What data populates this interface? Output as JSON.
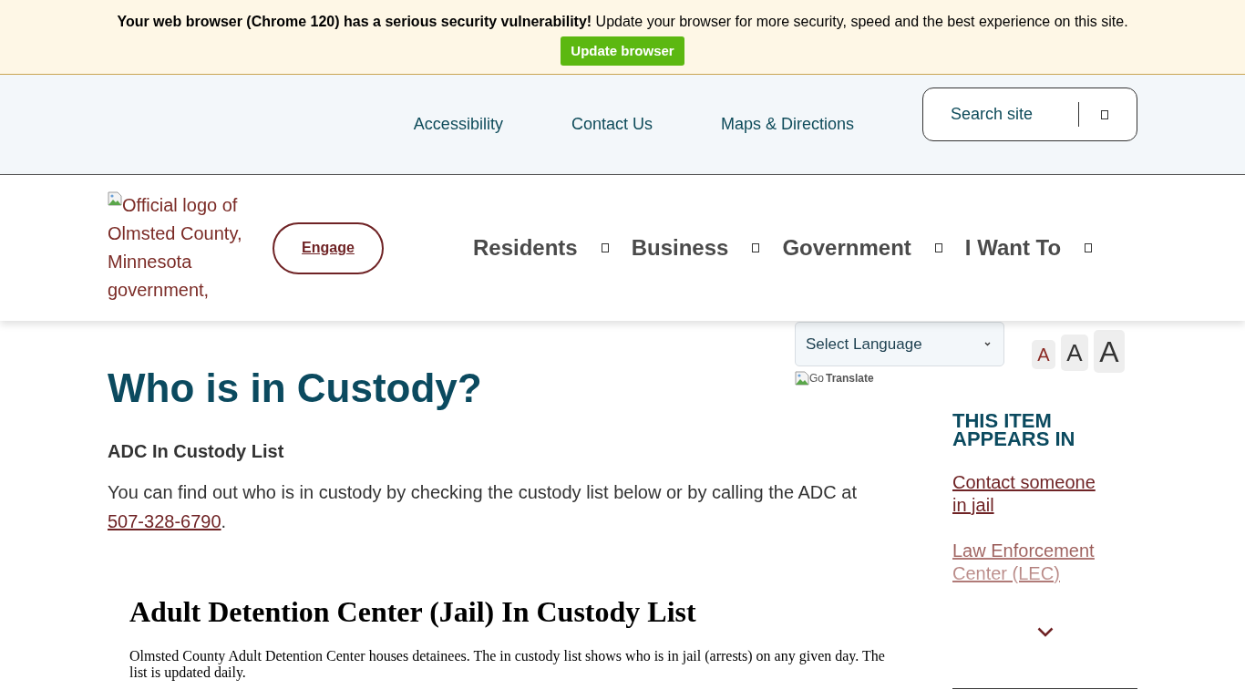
{
  "browser_warning": {
    "message": "**Your web browser (Chrome 120) has a serious security vulnerability!** Update your browser for more security, speed and the best experience on this site.",
    "button": "Update browser"
  },
  "utility_nav": {
    "links": [
      "Accessibility",
      "Contact Us",
      "Maps & Directions"
    ],
    "search": {
      "placeholder": "Search site"
    }
  },
  "header": {
    "logo_alt": "Official logo of Olmsted County, Minnesota government,",
    "engage_button": "Engage",
    "menu": [
      "Residents",
      "Business",
      "Government",
      "I Want To"
    ]
  },
  "translate": {
    "select": "Select Language",
    "logo_alt": "Go",
    "label": "Translate"
  },
  "font_sizes": [
    {
      "label": "A",
      "kind": "small",
      "selected": true
    },
    {
      "label": "A",
      "kind": "medium",
      "selected": false
    },
    {
      "label": "A",
      "kind": "large",
      "selected": false
    }
  ],
  "page": {
    "title": "Who is in Custody?",
    "subtitle": "ADC In Custody List",
    "intro": {
      "text": "You can find out who is in custody by checking the custody list below or by calling the ADC at",
      "link": "507-328-6790",
      "after": "."
    },
    "embedded_document": {
      "title": "Adult Detention Center (Jail) In Custody List",
      "text": "Olmsted County Adult Detention Center houses detainees. The in custody list shows who is in jail (arrests) on any given day. The list is updated daily."
    }
  },
  "sidebar": {
    "heading": "THIS ITEM APPEARS IN",
    "links": [
      {
        "label": "Contact someone in jail",
        "faded": false
      },
      {
        "label": "Law Enforcement Center (LEC)",
        "faded": true
      }
    ]
  }
}
